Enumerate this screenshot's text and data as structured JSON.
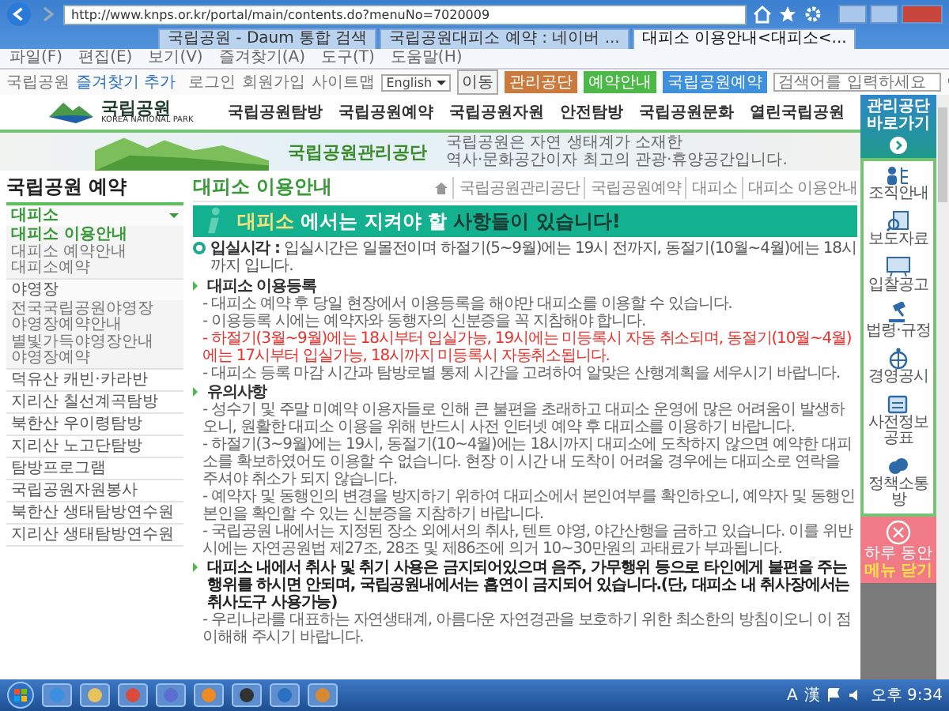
{
  "browser": {
    "url": "http://www.knps.or.kr/portal/main/contents.do?menuNo=7020009",
    "tabs": [
      {
        "label": "국립공원 - Daum 통합 검색",
        "selected": false
      },
      {
        "label": "국립공원대피소 예약 : 네이버 ...",
        "selected": false
      },
      {
        "label": "대피소 이용안내<대피소<...",
        "selected": true
      }
    ],
    "menu": [
      "파일(F)",
      "편집(E)",
      "보기(V)",
      "즐겨찾기(A)",
      "도구(T)",
      "도움말(H)"
    ]
  },
  "site_header": {
    "favorite_text": "국립공원",
    "favorite_link": "즐겨찾기 추가",
    "util_links": [
      "로그인",
      "회원가입",
      "사이트맵"
    ],
    "language": "English",
    "go_button": "이동",
    "quick_buttons": [
      {
        "label": "관리공단",
        "color": "#c97a3c"
      },
      {
        "label": "예약안내",
        "color": "#4cb848"
      },
      {
        "label": "국립공원예약",
        "color": "#3e8fdc"
      }
    ],
    "search_placeholder": "검색어를 입력하세요"
  },
  "logo": {
    "name": "국립공원",
    "subtitle": "KOREA NATIONAL PARK"
  },
  "nav": [
    "국립공원탐방",
    "국립공원예약",
    "국립공원자원",
    "안전탐방",
    "국립공원문화",
    "열린국립공원"
  ],
  "banner": {
    "title": "국립공원관리공단",
    "lines": [
      "국립공원은 자연 생태계가 소재한",
      "역사·문화공간이자 최고의 관광·휴양공간입니다."
    ]
  },
  "sidebar": {
    "title": "국립공원 예약",
    "items": [
      {
        "label": "대피소",
        "selected": true,
        "expanded": true,
        "children": [
          {
            "label": "대피소 이용안내",
            "selected": true
          },
          {
            "label": "대피소 예약안내",
            "selected": false
          },
          {
            "label": "대피소예약",
            "selected": false
          }
        ]
      },
      {
        "label": "야영장",
        "selected": false,
        "expanded": true,
        "children": [
          {
            "label": "전국국립공원야영장",
            "selected": false
          },
          {
            "label": "야영장예약안내",
            "selected": false
          },
          {
            "label": "별빛가득야영장안내",
            "selected": false
          },
          {
            "label": "야영장예약",
            "selected": false
          }
        ]
      },
      {
        "label": "덕유산 캐빈·카라반",
        "selected": false
      },
      {
        "label": "지리산 칠선계곡탐방",
        "selected": false
      },
      {
        "label": "북한산 우이령탐방",
        "selected": false
      },
      {
        "label": "지리산 노고단탐방",
        "selected": false
      },
      {
        "label": "탐방프로그램",
        "selected": false
      },
      {
        "label": "국립공원자원봉사",
        "selected": false
      },
      {
        "label": "북한산 생태탐방연수원",
        "selected": false
      },
      {
        "label": "지리산 생태탐방연수원",
        "selected": false
      }
    ]
  },
  "page": {
    "title": "대피소 이용안내",
    "breadcrumb": [
      "국립공원관리공단",
      "국립공원예약",
      "대피소",
      "대피소 이용안내"
    ],
    "notice": [
      {
        "text": "대피소",
        "color": "#f5e27a"
      },
      {
        "text": "에서는 지켜야 할",
        "color": "#ffffff"
      },
      {
        "text": "사항들이 있습니다!",
        "color": "#1d3b33"
      }
    ],
    "checkin": "**입실시각 :** 입실시간은 일몰전이며 하절기(5~9월)에는 19시 전까지, 동절기(10월~4월)에는 18시까지 입니다.",
    "sections": [
      {
        "heading": "대피소 이용등록",
        "kind": "plain",
        "items": [
          {
            "text": "- 대피소 예약 후 당일 현장에서 이용등록을 해야만 대피소를 이용할 수 있습니다.",
            "kind": "normal"
          },
          {
            "text": "- 이용등록 시에는 예약자와 동행자의 신분증을 꼭 지참해야 합니다.",
            "kind": "normal"
          },
          {
            "text": "- 하절기(3월~9월)에는 18시부터 입실가능, 19시에는 미등록시 자동 취소되며, 동절기(10월~4월)에는 17시부터 입실가능, 18시까지 미등록시 자동취소됩니다.",
            "kind": "warning"
          },
          {
            "text": "- 대피소 등록 마감 시간과 탐방로별 통제 시간을 고려하여 알맞은 산행계획을 세우시기 바랍니다.",
            "kind": "normal"
          }
        ]
      },
      {
        "heading": "유의사항",
        "kind": "plain",
        "items": [
          {
            "text": "- 성수기 및 주말 미예약 이용자들로 인해 큰 불편을 초래하고 대피소 운영에 많은 어려움이 발생하오니, 원활한 대피소 이용을 위해 반드시 사전 인터넷 예약 후 대피소를 이용하기 바랍니다.",
            "kind": "normal"
          },
          {
            "text": "- 하절기(3~9월)에는 19시, 동절기(10~4월)에는 18시까지 대피소에 도착하지 않으면 예약한 대피소를 확보하였어도 이용할 수 없습니다. 현장 이 시간 내 도착이 어려울 경우에는 대피소로 연락을 주셔야 취소가 되지 않습니다.",
            "kind": "normal"
          },
          {
            "text": "- 예약자 및 동행인의 변경을 방지하기 위하여 대피소에서 본인여부를 확인하오니, 예약자 및 동행인 본인을 확인할 수 있는 신분증을 지참하기 바랍니다.",
            "kind": "normal"
          },
          {
            "text": "- 국립공원 내에서는 지정된 장소 외에서의 취사, 텐트 야영, 야간산행을 금하고 있습니다. 이를 위반시에는 자연공원법 제27조, 28조 및 제86조에 의거 10~30만원의 과태료가 부과됩니다.",
            "kind": "normal"
          }
        ]
      },
      {
        "heading": "대피소 내에서 취사 및 취기 사용은 금지되어있으며 음주, 가무행위 등으로 타인에게 불편을 주는 행위를 하시면 안되며, 국립공원내에서는 흡연이 금지되어 있습니다.(단, 대피소 내 취사장에서는 취사도구 사용가능)",
        "kind": "bold",
        "items": [
          {
            "text": "- 우리나라를 대표하는 자연생태계, 아름다운 자연경관을 보호하기 위한 최소한의 방침이오니 이 점 이해해 주시기 바랍니다.",
            "kind": "normal"
          }
        ]
      }
    ]
  },
  "rail": {
    "header": "관리공단 바로가기",
    "items": [
      "조직안내",
      "보도자료",
      "입찰공고",
      "법령·규정",
      "경영공시",
      "사전정보공표",
      "정책소통방"
    ],
    "close_label": "하루 동안",
    "close_action": "메뉴 닫기"
  },
  "taskbar": {
    "ime": [
      "A",
      "漢"
    ],
    "clock": "오후 9:34"
  }
}
